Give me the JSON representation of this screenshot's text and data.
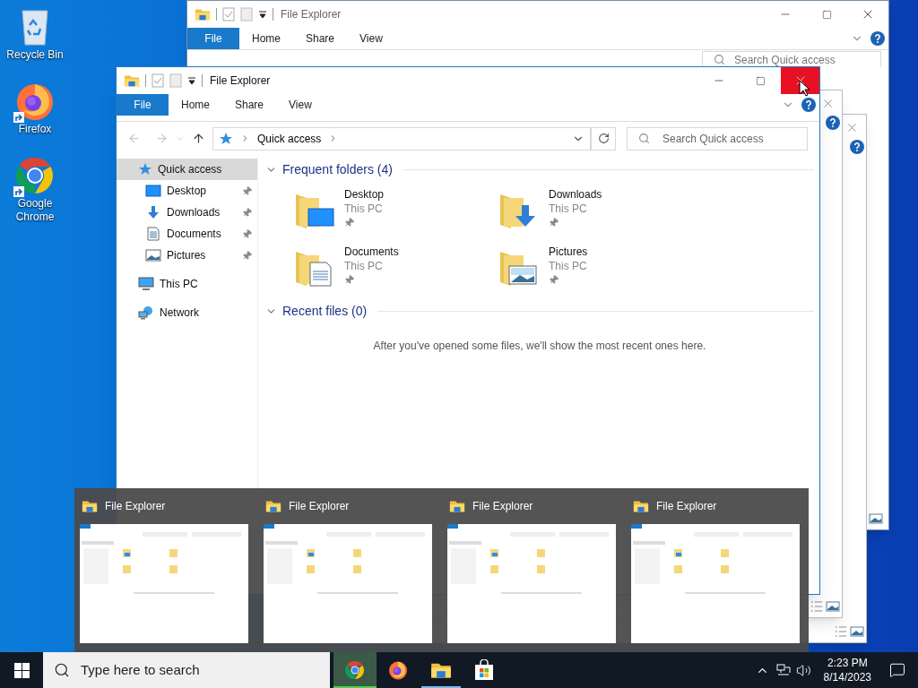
{
  "desktop_icons": [
    {
      "label": "Recycle Bin",
      "shortcut": false
    },
    {
      "label": "Firefox",
      "shortcut": true
    },
    {
      "label": "Google Chrome",
      "shortcut": true
    }
  ],
  "back_window": {
    "title": "File Explorer",
    "ribbon_tabs": [
      {
        "label": "File",
        "kind": "file"
      },
      {
        "label": "Home",
        "kind": "tab"
      },
      {
        "label": "Share",
        "kind": "tab"
      },
      {
        "label": "View",
        "kind": "tab"
      }
    ],
    "search": {
      "placeholder": "Search Quick access"
    }
  },
  "window": {
    "title": "File Explorer",
    "close_hovered": true,
    "ribbon_tabs": [
      {
        "label": "File",
        "kind": "file"
      },
      {
        "label": "Home",
        "kind": "tab"
      },
      {
        "label": "Share",
        "kind": "tab"
      },
      {
        "label": "View",
        "kind": "tab"
      }
    ],
    "address": {
      "path": "Quick access"
    },
    "search": {
      "placeholder": "Search Quick access"
    },
    "nav": [
      {
        "label": "Quick access",
        "selected": true,
        "children": [
          {
            "label": "Desktop",
            "selected": false,
            "pinned": true
          },
          {
            "label": "Downloads",
            "selected": false,
            "pinned": true
          },
          {
            "label": "Documents",
            "selected": false,
            "pinned": true
          },
          {
            "label": "Pictures",
            "selected": false,
            "pinned": true
          }
        ]
      },
      {
        "label": "This PC",
        "selected": false
      },
      {
        "label": "Network",
        "selected": false
      }
    ],
    "sections": [
      {
        "title": "Frequent folders (4)",
        "expanded": true,
        "folders": [
          {
            "name": "Desktop",
            "location": "This PC",
            "pinned": true
          },
          {
            "name": "Downloads",
            "location": "This PC",
            "pinned": true
          },
          {
            "name": "Documents",
            "location": "This PC",
            "pinned": true
          },
          {
            "name": "Pictures",
            "location": "This PC",
            "pinned": true
          }
        ]
      },
      {
        "title": "Recent files (0)",
        "expanded": true,
        "message": "After you've opened some files, we'll show the most recent ones here."
      }
    ]
  },
  "thumbnails": [
    {
      "title": "File Explorer"
    },
    {
      "title": "File Explorer"
    },
    {
      "title": "File Explorer"
    },
    {
      "title": "File Explorer"
    }
  ],
  "taskbar": {
    "search": {
      "placeholder": "Type here to search"
    },
    "apps": [
      {
        "kind": "chrome",
        "highlighted": true,
        "running": true
      },
      {
        "kind": "firefox",
        "highlighted": false,
        "running": false
      },
      {
        "kind": "explorer",
        "highlighted": false,
        "running": true
      },
      {
        "kind": "store",
        "highlighted": false,
        "running": false
      }
    ],
    "time": "2:23 PM",
    "date": "8/14/2023"
  }
}
